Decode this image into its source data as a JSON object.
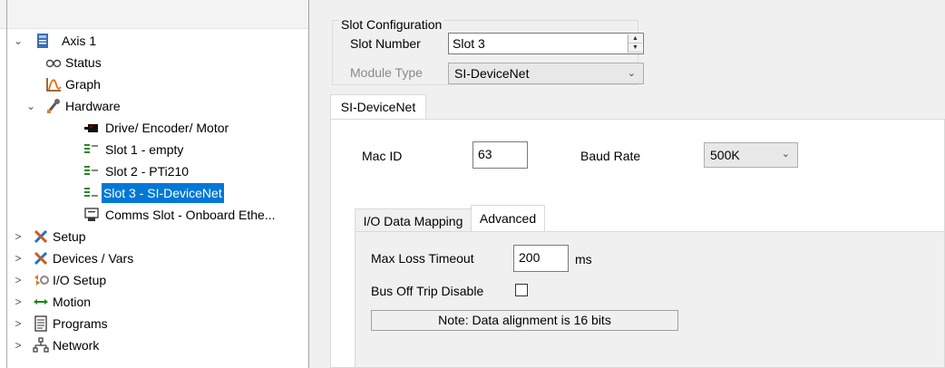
{
  "tree": {
    "items": [
      {
        "label": "Axis 1",
        "twisty": "⌄",
        "icon": "drive-axis-icon"
      },
      {
        "label": "Status",
        "icon": "status-icon"
      },
      {
        "label": "Graph",
        "icon": "graph-icon"
      },
      {
        "label": "Hardware",
        "twisty": "⌄",
        "icon": "hardware-wrench-icon"
      },
      {
        "label": "Drive/ Encoder/ Motor",
        "icon": "drive-encoder-icon"
      },
      {
        "label": "Slot 1 - empty",
        "icon": "slot-icon"
      },
      {
        "label": "Slot 2 - PTi210",
        "icon": "slot-icon"
      },
      {
        "label": "Slot 3 - SI-DeviceNet",
        "icon": "slot-icon"
      },
      {
        "label": "Comms Slot - Onboard Ethe...",
        "icon": "comms-slot-icon"
      },
      {
        "label": "Setup",
        "twisty": ">",
        "icon": "setup-tools-icon"
      },
      {
        "label": "Devices / Vars",
        "twisty": ">",
        "icon": "devices-tools-icon"
      },
      {
        "label": "I/O Setup",
        "twisty": ">",
        "icon": "io-setup-icon"
      },
      {
        "label": "Motion",
        "twisty": ">",
        "icon": "motion-arrows-icon"
      },
      {
        "label": "Programs",
        "twisty": ">",
        "icon": "programs-icon"
      },
      {
        "label": "Network",
        "twisty": ">",
        "icon": "network-icon"
      }
    ],
    "selected_index": 7
  },
  "slot_config": {
    "legend": "Slot Configuration",
    "slot_number_label": "Slot Number",
    "slot_number_value": "Slot 3",
    "module_type_label": "Module Type",
    "module_type_value": "SI-DeviceNet"
  },
  "module_tab": {
    "label": "SI-DeviceNet"
  },
  "devicenet": {
    "mac_id_label": "Mac ID",
    "mac_id_value": "63",
    "baud_rate_label": "Baud Rate",
    "baud_rate_value": "500K"
  },
  "subtabs": {
    "io_data_mapping": "I/O Data Mapping",
    "advanced": "Advanced",
    "active": "Advanced"
  },
  "advanced": {
    "max_loss_timeout_label": "Max Loss Timeout",
    "max_loss_timeout_value": "200",
    "max_loss_timeout_unit": "ms",
    "bus_off_trip_disable_label": "Bus Off Trip Disable",
    "bus_off_trip_disable_checked": false,
    "note": "Note: Data alignment is 16 bits"
  },
  "colors": {
    "selection": "#0078d7",
    "selection_row": "#cce8ff"
  }
}
